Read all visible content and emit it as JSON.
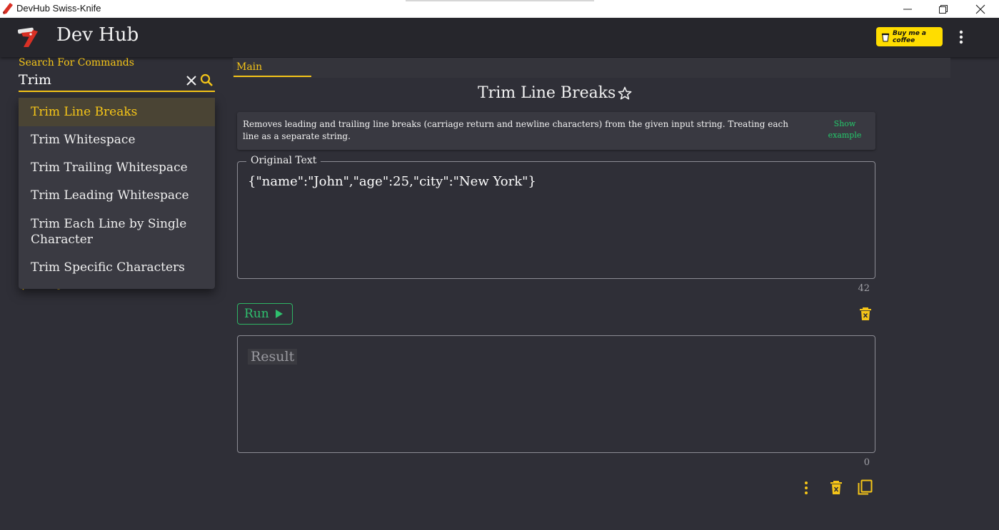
{
  "window": {
    "title": "DevHub Swiss-Knife",
    "icon": "app-knife-icon"
  },
  "header": {
    "title": "Dev Hub",
    "coffee_label": "Buy me a coffee"
  },
  "search": {
    "label": "Search For Commands",
    "value": "Trim",
    "results": [
      "Trim Line Breaks",
      "Trim Whitespace",
      "Trim Trailing Whitespace",
      "Trim Leading Whitespace",
      "Trim Each Line by Single Character",
      "Trim Specific Characters"
    ],
    "active_index": 0
  },
  "tabs": {
    "main": "Main"
  },
  "command": {
    "title": "Trim Line Breaks",
    "description": "Removes leading and trailing line breaks (carriage return and newline characters) from the given input string. Treating each line as a separate string.",
    "show_example": "Show example"
  },
  "input": {
    "legend": "Original Text",
    "value": "{\"name\":\"John\",\"age\":25,\"city\":\"New York\"}",
    "char_count": "42"
  },
  "run": {
    "label": "Run"
  },
  "output": {
    "placeholder": "Result",
    "char_count": "0"
  },
  "colors": {
    "accent": "#f5c518",
    "run_green": "#2fc06e",
    "background": "#2f2f37",
    "header": "#26262c"
  }
}
